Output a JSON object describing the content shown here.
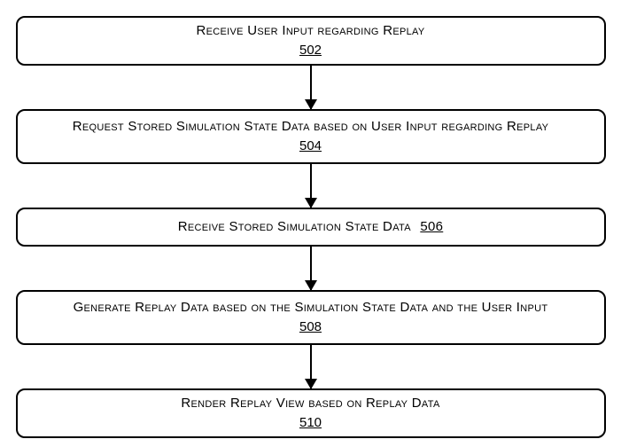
{
  "chart_data": {
    "type": "flowchart",
    "direction": "top-to-bottom",
    "nodes": [
      {
        "id": "502",
        "label": "Receive User Input regarding Replay",
        "ref": "502"
      },
      {
        "id": "504",
        "label": "Request Stored Simulation State Data based on User Input regarding Replay",
        "ref": "504"
      },
      {
        "id": "506",
        "label": "Receive Stored Simulation State Data",
        "ref": "506"
      },
      {
        "id": "508",
        "label": "Generate Replay Data based on the Simulation State Data and the User Input",
        "ref": "508"
      },
      {
        "id": "510",
        "label": "Render Replay View based on Replay Data",
        "ref": "510"
      }
    ],
    "edges": [
      {
        "from": "502",
        "to": "504"
      },
      {
        "from": "504",
        "to": "506"
      },
      {
        "from": "506",
        "to": "508"
      },
      {
        "from": "508",
        "to": "510"
      }
    ]
  }
}
